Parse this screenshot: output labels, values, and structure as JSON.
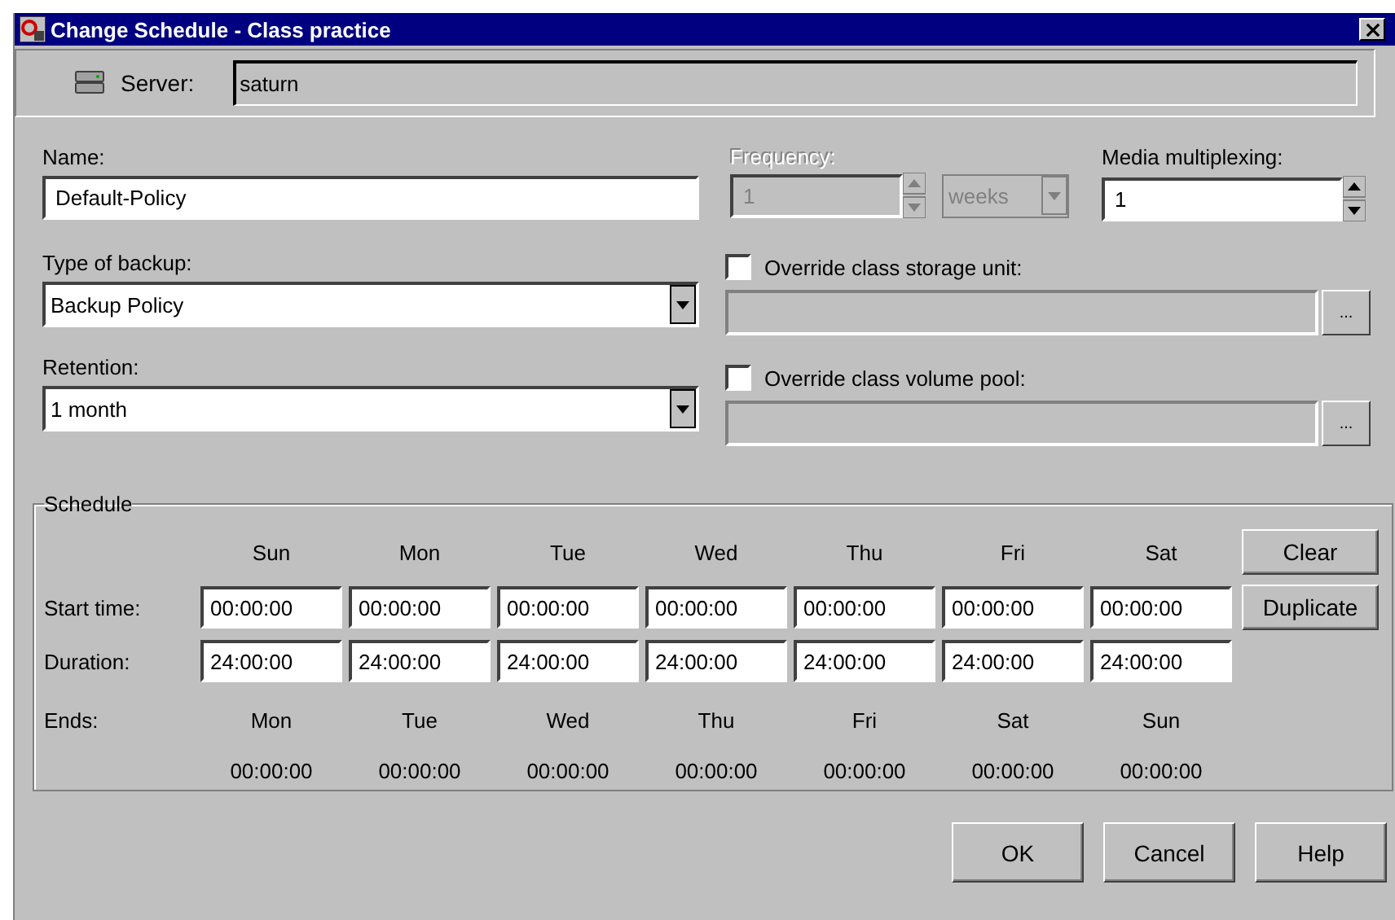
{
  "window": {
    "title": "Change Schedule - Class practice"
  },
  "server": {
    "label": "Server:",
    "value": "saturn"
  },
  "name": {
    "label": "Name:",
    "value": "Default-Policy"
  },
  "frequency": {
    "label": "Frequency:",
    "value": "1",
    "unit": "weeks",
    "disabled": true
  },
  "media_multiplexing": {
    "label": "Media multiplexing:",
    "value": "1"
  },
  "type_of_backup": {
    "label": "Type of backup:",
    "value": "Backup Policy"
  },
  "retention": {
    "label": "Retention:",
    "value": "1 month"
  },
  "overrides": [
    {
      "label": "Override class storage unit:",
      "checked": false,
      "browse": "..."
    },
    {
      "label": "Override class volume pool:",
      "checked": false,
      "browse": "..."
    }
  ],
  "schedule": {
    "title": "Schedule",
    "start_label": "Start time:",
    "duration_label": "Duration:",
    "ends_label": "Ends:",
    "days": [
      "Sun",
      "Mon",
      "Tue",
      "Wed",
      "Thu",
      "Fri",
      "Sat"
    ],
    "start_times": [
      "00:00:00",
      "00:00:00",
      "00:00:00",
      "00:00:00",
      "00:00:00",
      "00:00:00",
      "00:00:00"
    ],
    "durations": [
      "24:00:00",
      "24:00:00",
      "24:00:00",
      "24:00:00",
      "24:00:00",
      "24:00:00",
      "24:00:00"
    ],
    "end_days": [
      "Mon",
      "Tue",
      "Wed",
      "Thu",
      "Fri",
      "Sat",
      "Sun"
    ],
    "end_times": [
      "00:00:00",
      "00:00:00",
      "00:00:00",
      "00:00:00",
      "00:00:00",
      "00:00:00",
      "00:00:00"
    ],
    "buttons": [
      "Clear",
      "Duplicate"
    ]
  },
  "buttons": [
    "OK",
    "Cancel",
    "Help"
  ]
}
